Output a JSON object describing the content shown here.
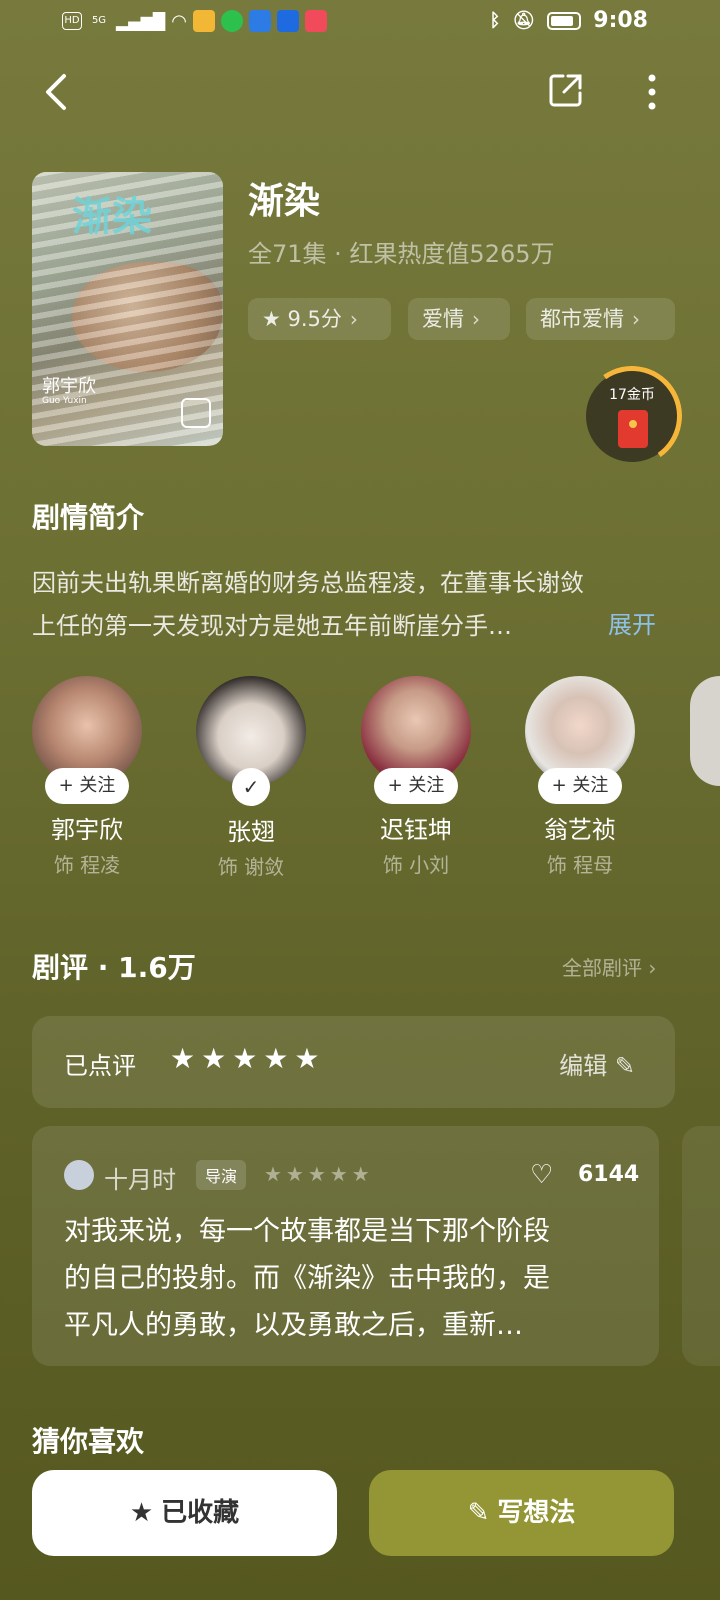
{
  "status_bar": {
    "left_icons": [
      "HD",
      "5G",
      "signal-icon",
      "wifi-icon",
      "weibo-icon",
      "wechat-icon",
      "app-icon",
      "app-icon",
      "music-icon"
    ],
    "hd": "HD",
    "net": "5G",
    "time": "9:08"
  },
  "drama": {
    "title": "渐染",
    "meta": "全71集 · 红果热度值5265万",
    "tags": [
      {
        "label": "9.5分",
        "icon": "star-icon"
      },
      {
        "label": "爱情"
      },
      {
        "label": "都市爱情"
      }
    ],
    "poster": {
      "title": "渐染",
      "actor_cn": "郭宇欣",
      "actor_en": "Guo Yuxin"
    },
    "coin_label": "17金币"
  },
  "synopsis": {
    "heading": "剧情简介",
    "lines": [
      "因前夫出轨果断离婚的财务总监程凌，在董事长谢敛",
      "上任的第一天发现对方是她五年前断崖分手…"
    ],
    "expand": "展开"
  },
  "cast": [
    {
      "name": "郭宇欣",
      "role": "饰 程凌",
      "follow": "+ 关注",
      "followed": false,
      "color": "#6b4a40"
    },
    {
      "name": "张翅",
      "role": "饰 谢敛",
      "follow": "✓",
      "followed": true,
      "color": "#2b2624"
    },
    {
      "name": "迟钰坤",
      "role": "饰 小刘",
      "follow": "+ 关注",
      "followed": false,
      "color": "#8a3040"
    },
    {
      "name": "翁艺祯",
      "role": "饰 程母",
      "follow": "+ 关注",
      "followed": false,
      "color": "#d8d6d2"
    }
  ],
  "reviews": {
    "heading": "剧评 · 1.6万",
    "all_link": "全部剧评 ›",
    "rated_label": "已点评",
    "rated_stars": "★★★★★",
    "edit_label": "编辑 ✎",
    "item": {
      "user": "十月时",
      "badge": "导演",
      "stars": "★★★★★",
      "likes": "6144",
      "lines": [
        "对我来说，每一个故事都是当下那个阶段",
        "的自己的投射。而《渐染》击中我的，是",
        "平凡人的勇敢，以及勇敢之后，重新…"
      ]
    }
  },
  "recommend": {
    "heading": "猜你喜欢"
  },
  "bottom": {
    "fav_label": "已收藏",
    "write_label": "写想法"
  },
  "colors": {
    "accent": "#949636",
    "link": "#8ec1e8",
    "coin_ring": "#f5b63a",
    "envelope": "#e23a2e"
  }
}
